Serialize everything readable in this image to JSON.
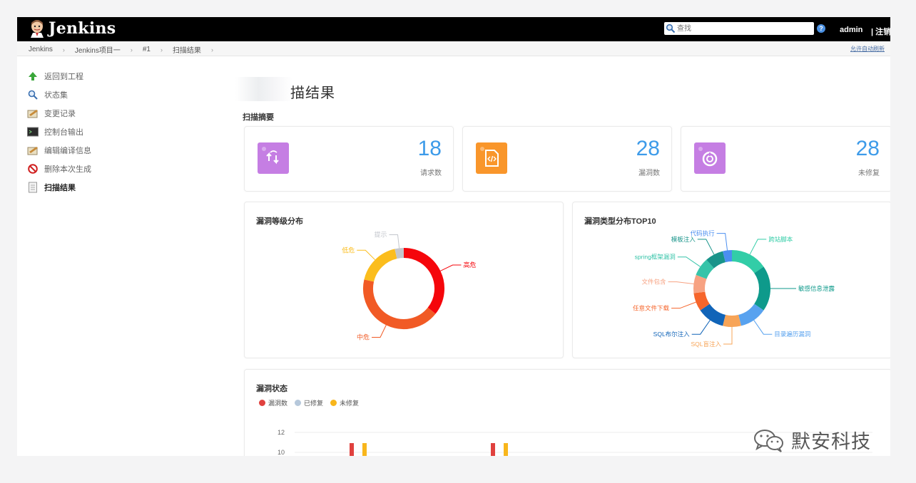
{
  "header": {
    "app_name": "Jenkins",
    "search_placeholder": "查找",
    "help_glyph": "?",
    "user": "admin",
    "logout": "| 注销"
  },
  "breadcrumbs": [
    "Jenkins",
    "Jenkins项目一",
    "#1",
    "扫描结果"
  ],
  "breadcrumb_separator": "›",
  "auto_refresh": "允许自动刷新",
  "sidebar": {
    "items": [
      {
        "label": "返回到工程",
        "icon": "up-arrow-icon"
      },
      {
        "label": "状态集",
        "icon": "search-icon"
      },
      {
        "label": "变更记录",
        "icon": "notepad-icon"
      },
      {
        "label": "控制台输出",
        "icon": "terminal-icon"
      },
      {
        "label": "编辑编译信息",
        "icon": "notepad-icon"
      },
      {
        "label": "删除本次生成",
        "icon": "no-entry-icon"
      },
      {
        "label": "扫描结果",
        "icon": "document-icon"
      }
    ]
  },
  "main": {
    "title": "描结果",
    "summary_label": "扫描摘要",
    "stats": [
      {
        "value": "18",
        "label": "请求数",
        "color": "#c57ee3",
        "icon": "transfer-icon"
      },
      {
        "value": "28",
        "label": "漏洞数",
        "color": "#f9962b",
        "icon": "code-file-icon"
      },
      {
        "value": "28",
        "label": "未修复",
        "color": "#c57ee3",
        "icon": "ring-chart-icon"
      }
    ],
    "level_chart_title": "漏洞等级分布",
    "type_chart_title": "漏洞类型分布TOP10",
    "status_chart_title": "漏洞状态"
  },
  "chart_data": [
    {
      "type": "pie",
      "title": "漏洞等级分布",
      "categories": [
        "高危",
        "中危",
        "低危",
        "提示"
      ],
      "values": [
        10,
        12,
        5,
        1
      ],
      "colors": [
        "#f5060b",
        "#f15a25",
        "#fbbd1d",
        "#c3c6cc"
      ]
    },
    {
      "type": "pie",
      "title": "漏洞类型分布TOP10",
      "categories": [
        "跨站脚本",
        "敏感信息泄露",
        "目录遍历漏洞",
        "SQL盲注入",
        "SQL布尔注入",
        "任意文件下载",
        "文件包含",
        "spring框架漏洞",
        "模板注入",
        "代码执行"
      ],
      "values": [
        4,
        5,
        3,
        2,
        3,
        2,
        2,
        2,
        2,
        1
      ],
      "colors": [
        "#32cda7",
        "#0e9a8b",
        "#58a2ef",
        "#f7a457",
        "#1164b8",
        "#f6652b",
        "#f7a282",
        "#36c4a9",
        "#18948a",
        "#4b8ef0"
      ]
    },
    {
      "type": "bar",
      "title": "漏洞状态",
      "series": [
        {
          "name": "漏洞数",
          "color": "#e0413e"
        },
        {
          "name": "已修复",
          "color": "#b6c8db"
        },
        {
          "name": "未修复",
          "color": "#f8b61c"
        }
      ],
      "y_ticks": [
        "12",
        "10"
      ]
    }
  ]
}
